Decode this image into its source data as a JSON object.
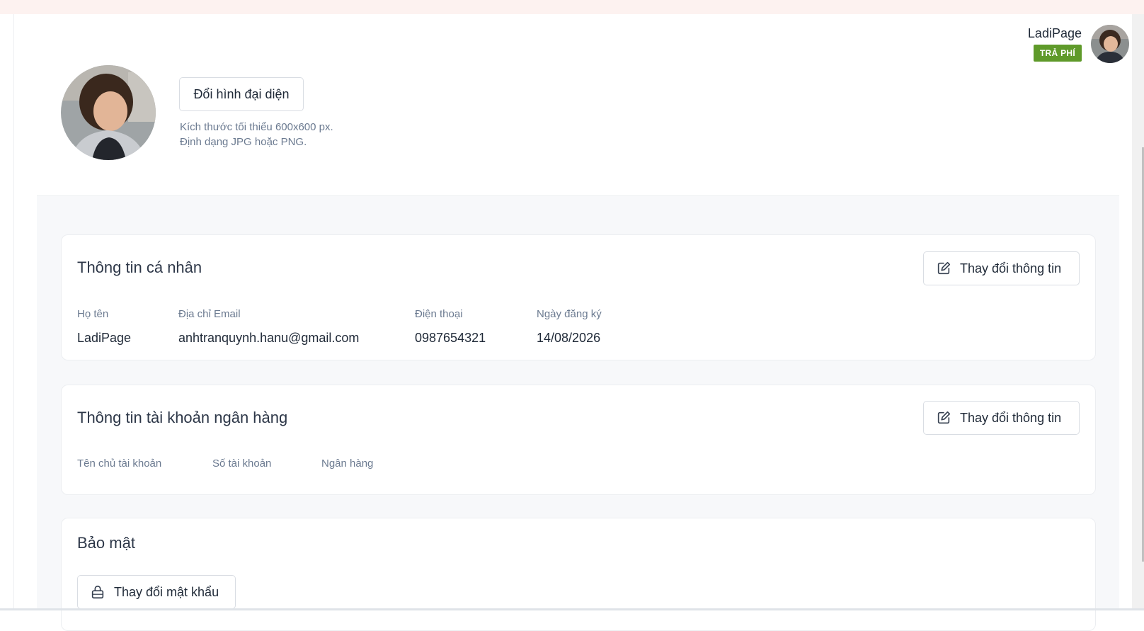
{
  "header": {
    "user_name": "LadiPage",
    "plan_badge": "TRẢ PHÍ",
    "avatar_icon": "user-avatar-photo"
  },
  "profile_photo": {
    "change_button": "Đổi hình đại diện",
    "hint_size": "Kích thước tối thiểu 600x600 px.",
    "hint_format": "Định dạng JPG hoặc PNG."
  },
  "personal_info": {
    "title": "Thông tin cá nhân",
    "edit_button": "Thay đổi thông tin",
    "fields": [
      {
        "label": "Họ tên",
        "value": "LadiPage"
      },
      {
        "label": "Địa chỉ Email",
        "value": "anhtranquynh.hanu@gmail.com"
      },
      {
        "label": "Điện thoại",
        "value": "0987654321"
      },
      {
        "label": "Ngày đăng ký",
        "value": "14/08/2026"
      }
    ]
  },
  "bank_info": {
    "title": "Thông tin tài khoản ngân hàng",
    "edit_button": "Thay đổi thông tin",
    "fields": [
      {
        "label": "Tên chủ tài khoản",
        "value": ""
      },
      {
        "label": "Số tài khoản",
        "value": ""
      },
      {
        "label": "Ngân hàng",
        "value": ""
      }
    ]
  },
  "security": {
    "title": "Bảo mật",
    "change_password_button": "Thay đổi mật khẩu"
  },
  "colors": {
    "badge": "#5f9a2a",
    "label": "#6b7a90",
    "text": "#1f2937",
    "content_bg": "#f7f8fa"
  }
}
